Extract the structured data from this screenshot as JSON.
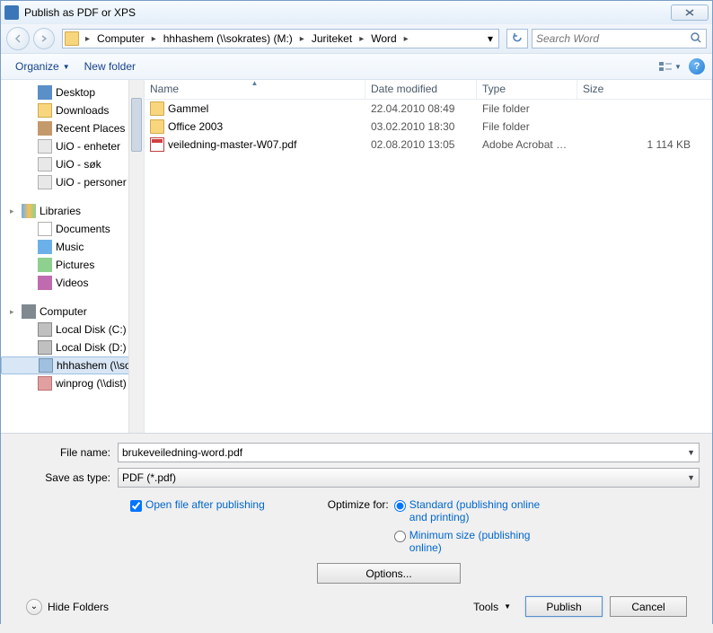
{
  "title": "Publish as PDF or XPS",
  "breadcrumb": [
    "Computer",
    "hhhashem (\\\\sokrates) (M:)",
    "Juriteket",
    "Word"
  ],
  "search_placeholder": "Search Word",
  "toolbar": {
    "organize": "Organize",
    "newfolder": "New folder"
  },
  "sidebar": {
    "favorites": [
      {
        "label": "Desktop",
        "icon": "desktop"
      },
      {
        "label": "Downloads",
        "icon": "down"
      },
      {
        "label": "Recent Places",
        "icon": "recent"
      },
      {
        "label": "UiO - enheter",
        "icon": "shortcut"
      },
      {
        "label": "UiO - søk",
        "icon": "shortcut"
      },
      {
        "label": "UiO - personer",
        "icon": "shortcut"
      }
    ],
    "libraries_label": "Libraries",
    "libraries": [
      {
        "label": "Documents",
        "icon": "doc"
      },
      {
        "label": "Music",
        "icon": "music"
      },
      {
        "label": "Pictures",
        "icon": "pic"
      },
      {
        "label": "Videos",
        "icon": "vid"
      }
    ],
    "computer_label": "Computer",
    "computer": [
      {
        "label": "Local Disk (C:)",
        "icon": "disk"
      },
      {
        "label": "Local Disk (D:)",
        "icon": "disk"
      },
      {
        "label": "hhhashem (\\\\sok",
        "icon": "net",
        "selected": true
      },
      {
        "label": "winprog (\\\\dist) (",
        "icon": "netx"
      }
    ]
  },
  "columns": {
    "name": "Name",
    "date": "Date modified",
    "type": "Type",
    "size": "Size"
  },
  "files": [
    {
      "name": "Gammel",
      "date": "22.04.2010 08:49",
      "type": "File folder",
      "size": "",
      "icon": "folder"
    },
    {
      "name": "Office 2003",
      "date": "03.02.2010 18:30",
      "type": "File folder",
      "size": "",
      "icon": "folder"
    },
    {
      "name": "veiledning-master-W07.pdf",
      "date": "02.08.2010 13:05",
      "type": "Adobe Acrobat D...",
      "size": "1 114 KB",
      "icon": "pdf"
    }
  ],
  "filename_label": "File name:",
  "filename_value": "brukeveiledning-word.pdf",
  "savetype_label": "Save as type:",
  "savetype_value": "PDF (*.pdf)",
  "open_after": "Open file after publishing",
  "optimize_label": "Optimize for:",
  "opt_standard": "Standard (publishing online and printing)",
  "opt_minimum": "Minimum size (publishing online)",
  "options_btn": "Options...",
  "hide_folders": "Hide Folders",
  "tools": "Tools",
  "publish": "Publish",
  "cancel": "Cancel"
}
